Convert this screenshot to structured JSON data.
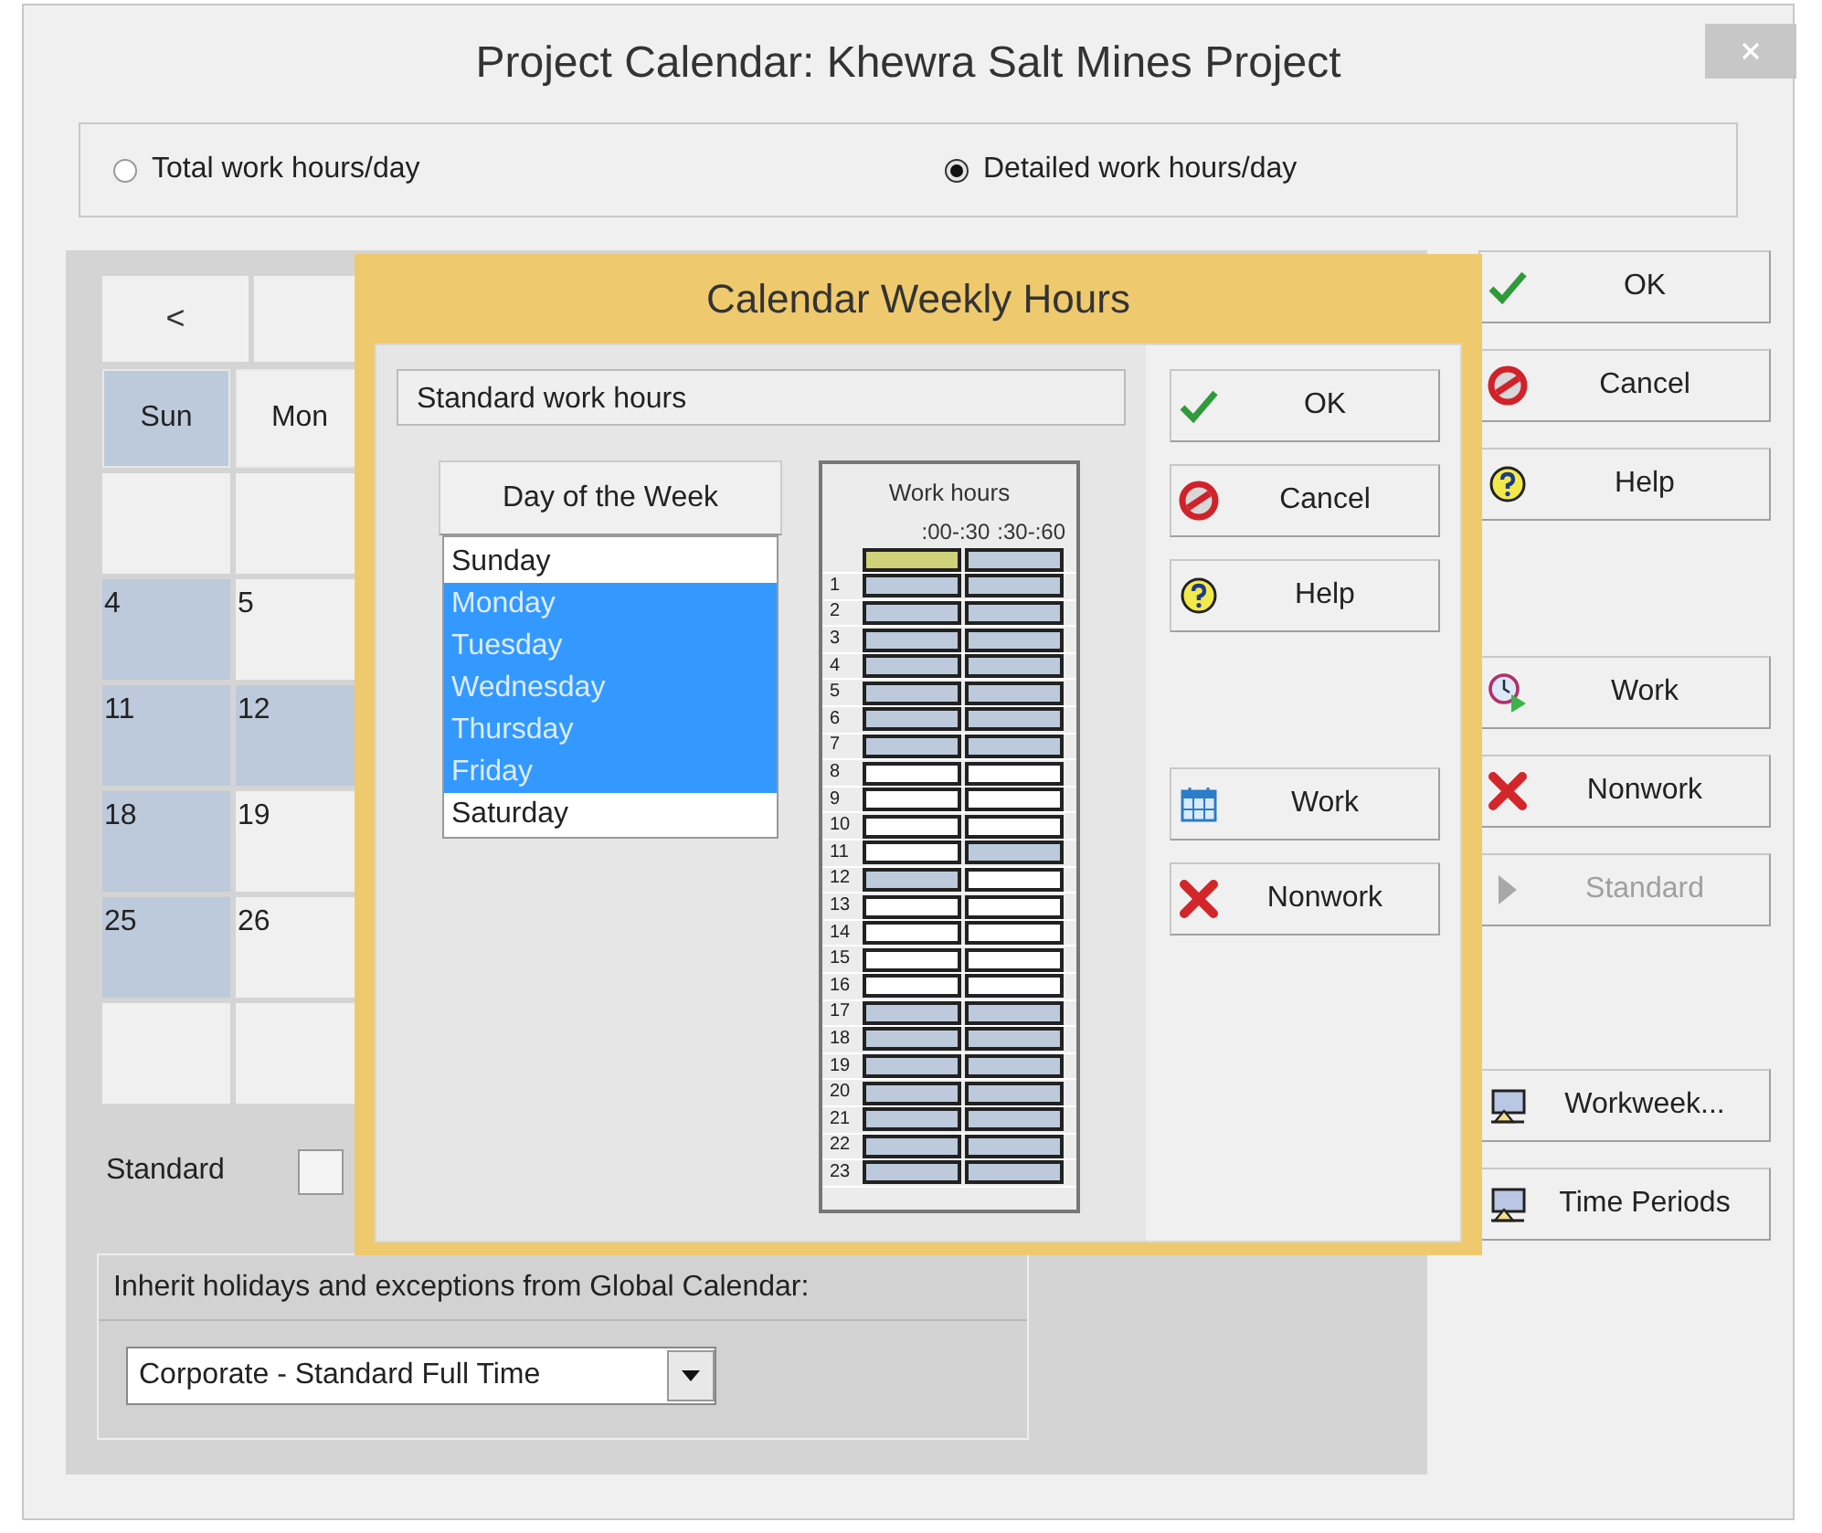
{
  "window": {
    "title": "Project Calendar: Khewra Salt Mines Project"
  },
  "hours_mode": [
    {
      "label": "Total work hours/day",
      "selected": false
    },
    {
      "label": "Detailed work hours/day",
      "selected": true
    }
  ],
  "calendar": {
    "prev": "<",
    "day_headers": [
      {
        "label": "Sun",
        "selected": true
      },
      {
        "label": "Mon",
        "selected": false
      }
    ],
    "weeks": [
      [
        {
          "nonwork": false
        },
        {
          "nonwork": false
        }
      ],
      [
        {
          "day": "4",
          "nonwork": true
        },
        {
          "day": "5",
          "nonwork": false
        }
      ],
      [
        {
          "day": "11",
          "nonwork": true
        },
        {
          "day": "12",
          "nonwork": true
        }
      ],
      [
        {
          "day": "18",
          "nonwork": true
        },
        {
          "day": "19",
          "nonwork": false
        }
      ],
      [
        {
          "day": "25",
          "nonwork": true
        },
        {
          "day": "26",
          "nonwork": false
        }
      ],
      [
        {
          "nonwork": false
        },
        {
          "nonwork": false
        }
      ]
    ]
  },
  "standard": {
    "label": "Standard",
    "checked": false
  },
  "inherit": {
    "label": "Inherit holidays and exceptions from Global Calendar:",
    "value": "Corporate - Standard Full Time"
  },
  "buttons": [
    {
      "kind": "ok",
      "label": "OK",
      "disabled": false
    },
    {
      "kind": "cancel",
      "label": "Cancel",
      "disabled": false
    },
    {
      "kind": "help",
      "label": "Help",
      "disabled": false
    },
    {
      "kind": "gap"
    },
    {
      "kind": "work",
      "label": "Work",
      "disabled": false
    },
    {
      "kind": "nonwork",
      "label": "Nonwork",
      "disabled": false
    },
    {
      "kind": "standard",
      "label": "Standard",
      "disabled": true
    },
    {
      "kind": "gap2"
    },
    {
      "kind": "workweek",
      "label": "Workweek...",
      "disabled": false
    },
    {
      "kind": "periods",
      "label": "Time Periods",
      "disabled": false
    }
  ],
  "dialog": {
    "title": "Calendar Weekly Hours",
    "section": "Standard work hours",
    "day_button": "Day of the Week",
    "days": [
      {
        "label": "Sunday",
        "selected": false
      },
      {
        "label": "Monday",
        "selected": true
      },
      {
        "label": "Tuesday",
        "selected": true
      },
      {
        "label": "Wednesday",
        "selected": true
      },
      {
        "label": "Thursday",
        "selected": true
      },
      {
        "label": "Friday",
        "selected": true
      },
      {
        "label": "Saturday",
        "selected": false
      }
    ],
    "grid_title": "Work hours",
    "grid_columns": [
      ":00-:30",
      ":30-:60"
    ],
    "hours": [
      {
        "slots": [
          {
            "work": false,
            "focused": true
          },
          {
            "work": false,
            "focused": false
          }
        ]
      },
      {
        "label": "1",
        "slots": [
          {
            "work": false,
            "focused": false
          },
          {
            "work": false,
            "focused": false
          }
        ]
      },
      {
        "label": "2",
        "slots": [
          {
            "work": false,
            "focused": false
          },
          {
            "work": false,
            "focused": false
          }
        ]
      },
      {
        "label": "3",
        "slots": [
          {
            "work": false,
            "focused": false
          },
          {
            "work": false,
            "focused": false
          }
        ]
      },
      {
        "label": "4",
        "slots": [
          {
            "work": false,
            "focused": false
          },
          {
            "work": false,
            "focused": false
          }
        ]
      },
      {
        "label": "5",
        "slots": [
          {
            "work": false,
            "focused": false
          },
          {
            "work": false,
            "focused": false
          }
        ]
      },
      {
        "label": "6",
        "slots": [
          {
            "work": false,
            "focused": false
          },
          {
            "work": false,
            "focused": false
          }
        ]
      },
      {
        "label": "7",
        "slots": [
          {
            "work": false,
            "focused": false
          },
          {
            "work": false,
            "focused": false
          }
        ]
      },
      {
        "label": "8",
        "slots": [
          {
            "work": true,
            "focused": false
          },
          {
            "work": true,
            "focused": false
          }
        ]
      },
      {
        "label": "9",
        "slots": [
          {
            "work": true,
            "focused": false
          },
          {
            "work": true,
            "focused": false
          }
        ]
      },
      {
        "label": "10",
        "slots": [
          {
            "work": true,
            "focused": false
          },
          {
            "work": true,
            "focused": false
          }
        ]
      },
      {
        "label": "11",
        "slots": [
          {
            "work": true,
            "focused": false
          },
          {
            "work": false,
            "focused": false
          }
        ]
      },
      {
        "label": "12",
        "slots": [
          {
            "work": false,
            "focused": false
          },
          {
            "work": true,
            "focused": false
          }
        ]
      },
      {
        "label": "13",
        "slots": [
          {
            "work": true,
            "focused": false
          },
          {
            "work": true,
            "focused": false
          }
        ]
      },
      {
        "label": "14",
        "slots": [
          {
            "work": true,
            "focused": false
          },
          {
            "work": true,
            "focused": false
          }
        ]
      },
      {
        "label": "15",
        "slots": [
          {
            "work": true,
            "focused": false
          },
          {
            "work": true,
            "focused": false
          }
        ]
      },
      {
        "label": "16",
        "slots": [
          {
            "work": true,
            "focused": false
          },
          {
            "work": true,
            "focused": false
          }
        ]
      },
      {
        "label": "17",
        "slots": [
          {
            "work": false,
            "focused": false
          },
          {
            "work": false,
            "focused": false
          }
        ]
      },
      {
        "label": "18",
        "slots": [
          {
            "work": false,
            "focused": false
          },
          {
            "work": false,
            "focused": false
          }
        ]
      },
      {
        "label": "19",
        "slots": [
          {
            "work": false,
            "focused": false
          },
          {
            "work": false,
            "focused": false
          }
        ]
      },
      {
        "label": "20",
        "slots": [
          {
            "work": false,
            "focused": false
          },
          {
            "work": false,
            "focused": false
          }
        ]
      },
      {
        "label": "21",
        "slots": [
          {
            "work": false,
            "focused": false
          },
          {
            "work": false,
            "focused": false
          }
        ]
      },
      {
        "label": "22",
        "slots": [
          {
            "work": false,
            "focused": false
          },
          {
            "work": false,
            "focused": false
          }
        ]
      },
      {
        "label": "23",
        "slots": [
          {
            "work": false,
            "focused": false
          },
          {
            "work": false,
            "focused": false
          }
        ]
      }
    ],
    "buttons": [
      {
        "kind": "ok",
        "label": "OK"
      },
      {
        "kind": "cancel",
        "label": "Cancel"
      },
      {
        "kind": "help",
        "label": "Help"
      },
      {
        "kind": "gap"
      },
      {
        "kind": "calendar",
        "label": "Work"
      },
      {
        "kind": "nonwork",
        "label": "Nonwork"
      }
    ]
  }
}
